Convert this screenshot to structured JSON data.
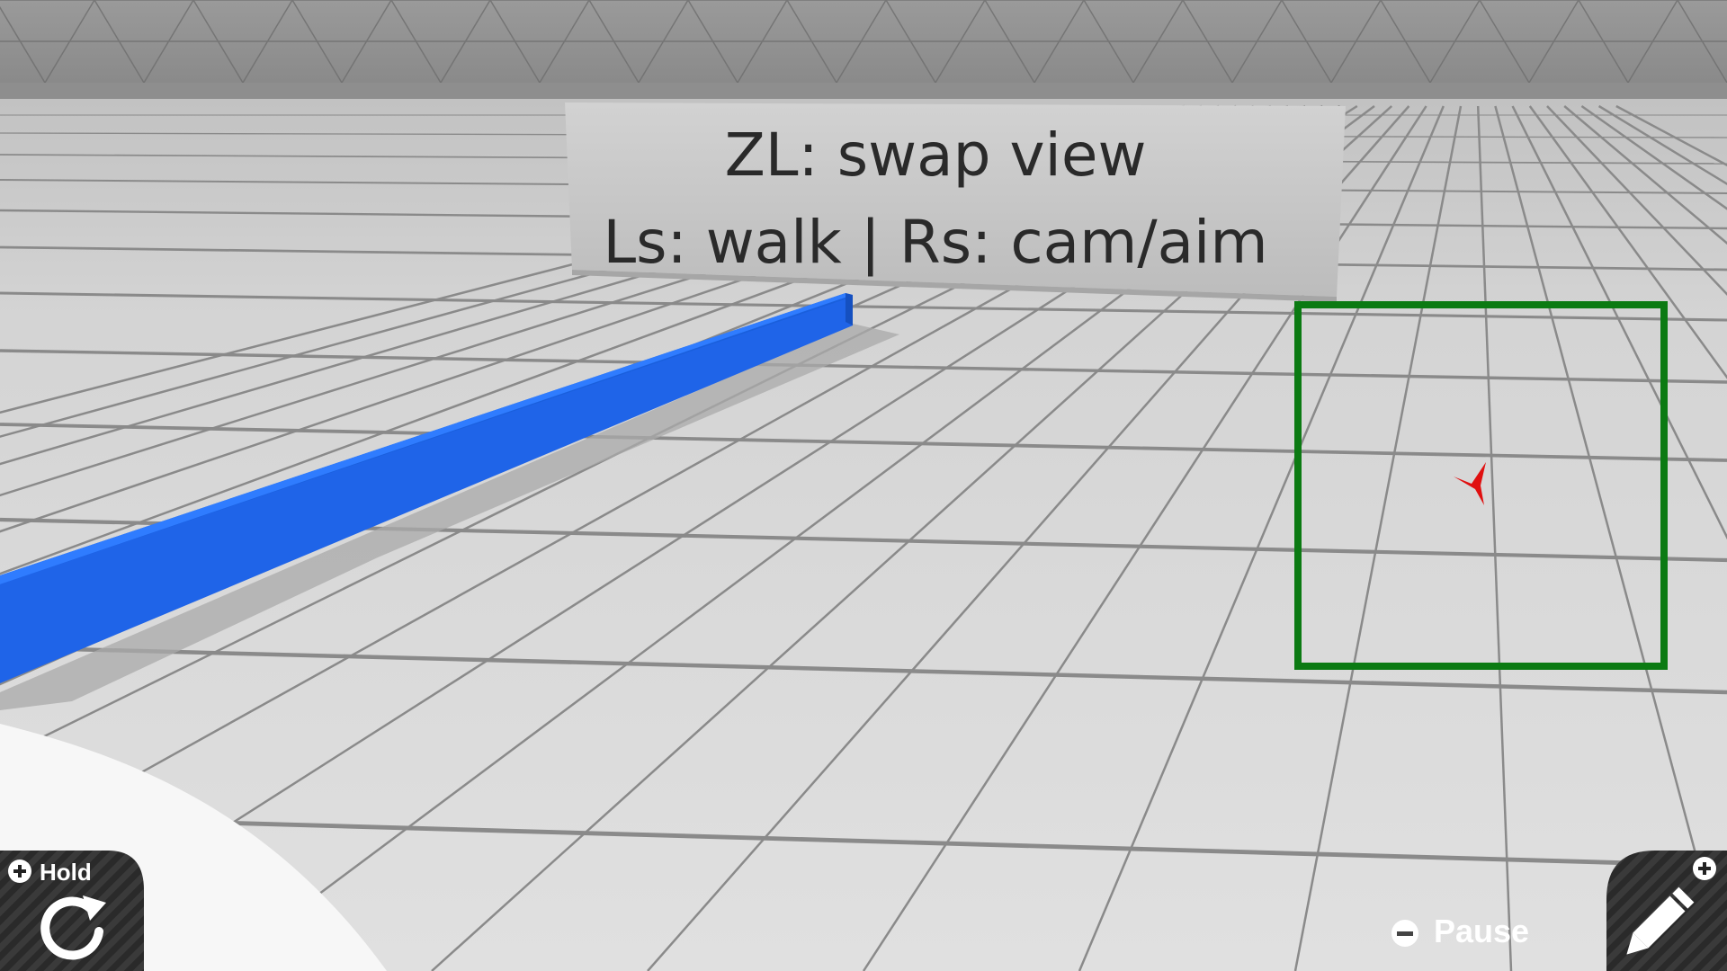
{
  "sign": {
    "line1": "ZL: swap view",
    "line2": "Ls: walk | Rs: cam/aim"
  },
  "hud": {
    "hold_button": {
      "label": "Hold",
      "modifier_icon": "plus-icon",
      "icon": "rotate-icon"
    },
    "pause_button": {
      "label": "Pause",
      "modifier_icon": "minus-icon"
    },
    "edit_button": {
      "modifier_icon": "plus-icon",
      "icon": "pencil-icon"
    }
  },
  "colors": {
    "target_frame": "#0b7a12",
    "cursor": "#e01010",
    "beam": "#1a64e6",
    "floor": "#d9d9d9",
    "wall": "#8c8c8c"
  }
}
